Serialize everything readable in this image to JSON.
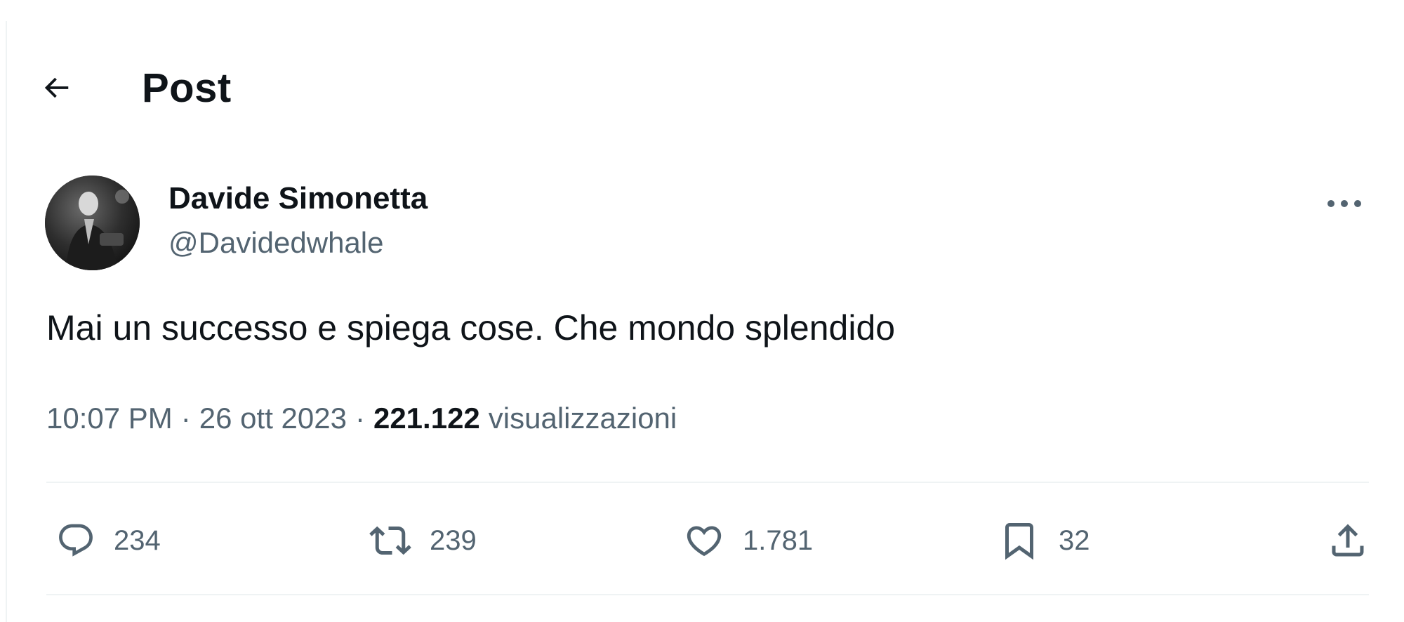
{
  "header": {
    "back_icon": "arrow-left-icon",
    "title": "Post"
  },
  "author": {
    "name": "Davide Simonetta",
    "handle": "@Davidedwhale",
    "avatar": "avatar-photo",
    "more_icon": "more-horizontal-icon"
  },
  "tweet": {
    "text": "Mai un successo e spiega cose. Che mondo splendido"
  },
  "meta": {
    "time": "10:07 PM",
    "separator": "·",
    "date": "26 ott 2023",
    "views_count": "221.122",
    "views_label": "visualizzazioni"
  },
  "actions": {
    "reply": {
      "icon": "reply-icon",
      "count": "234"
    },
    "retweet": {
      "icon": "retweet-icon",
      "count": "239"
    },
    "like": {
      "icon": "heart-icon",
      "count": "1.781"
    },
    "bookmark": {
      "icon": "bookmark-icon",
      "count": "32"
    },
    "share": {
      "icon": "share-icon"
    }
  },
  "colors": {
    "text_primary": "#0f1419",
    "text_secondary": "#536471",
    "divider": "#eff3f4"
  }
}
